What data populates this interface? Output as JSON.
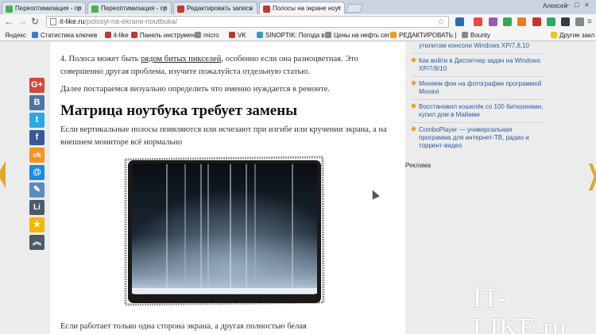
{
  "browser": {
    "tabs": [
      {
        "label": "Переоптимизация - пр",
        "favicon_color": "#4caf50",
        "active": false
      },
      {
        "label": "Переоптимизация - пр",
        "favicon_color": "#4caf50",
        "active": false
      },
      {
        "label": "Редактировать запись",
        "favicon_color": "#c0392b",
        "active": false
      },
      {
        "label": "Полосы на экране ноут",
        "favicon_color": "#c0392b",
        "active": true
      }
    ],
    "user_name": "Алексей",
    "window_controls": "–□×",
    "url_host": "it-like.ru",
    "url_path": "/polosyi-na-ekrane-noutbuka/",
    "bookmarks": [
      {
        "label": "Яндекс",
        "color": ""
      },
      {
        "label": "Статистика ключев",
        "color": "#3b7bd5"
      },
      {
        "label": "it-like",
        "color": "#c0392b"
      },
      {
        "label": "Панель инструмен",
        "color": "#c0392b"
      },
      {
        "label": "micro",
        "color": "#888888"
      },
      {
        "label": "VK",
        "color": "#c0392b"
      },
      {
        "label": "SINOPTIK: Погода в",
        "color": "#3498db"
      },
      {
        "label": "Цены на нефть сег",
        "color": "#888888"
      },
      {
        "label": "РЕДАКТИРОВАТЬ |",
        "color": "#f39c12"
      },
      {
        "label": "Bounty",
        "color": "#888888"
      },
      {
        "label": "Другие закл",
        "color": "#f1c40f"
      }
    ]
  },
  "article": {
    "p1_prefix": "4. Полоса может быть ",
    "p1_link": "рядом битых пикселей",
    "p1_suffix": ", особенно если она разноцветная. Это совершенно другая проблема, изучите пожалуйста отдельную статью.",
    "p2": "Далее постараемся визуально определить что именно нуждается в ремонте.",
    "heading": "Матрица ноутбука требует замены",
    "p3": "Если вертикальные полосы появляются или исчезают при изгибе или кручении экрана, а на внешнем мониторе всё нормально",
    "p4": "Если работает только одна сторона экрана, а другая полностью белая"
  },
  "sidebar": {
    "items": [
      "утилитам консоли Windows XP/7,8,10",
      "Как войти в Диспетчер задач на Windows XP/7/8/10",
      "Меняем фон на фотографии программой Movavi",
      "Восстановил кошелёк со 100 биткоинами, купил дом в Майами",
      "ComboPlayer — универсальная программа для интернет-ТВ, радио и торрент-видео"
    ],
    "ad_label": "Реклама"
  },
  "watermark": "IT-LIKE.ru",
  "social": [
    {
      "icon": "gplus-icon",
      "glyph": "G+",
      "color": "#d34836"
    },
    {
      "icon": "vk-icon",
      "glyph": "B",
      "color": "#4c75a3"
    },
    {
      "icon": "twitter-icon",
      "glyph": "t",
      "color": "#29a9e1"
    },
    {
      "icon": "facebook-icon",
      "glyph": "f",
      "color": "#3b5998"
    },
    {
      "icon": "odnoklassniki-icon",
      "glyph": "ok",
      "color": "#f7931e"
    },
    {
      "icon": "mailru-icon",
      "glyph": "@",
      "color": "#168de2"
    },
    {
      "icon": "livejournal-icon",
      "glyph": "✎",
      "color": "#5b8ac0"
    },
    {
      "icon": "liveinternet-icon",
      "glyph": "Li",
      "color": "#4d5a68"
    },
    {
      "icon": "favorites-icon",
      "glyph": "★",
      "color": "#f4b700"
    },
    {
      "icon": "scroll-up-icon",
      "glyph": "︽",
      "color": "#4d5a68"
    }
  ]
}
